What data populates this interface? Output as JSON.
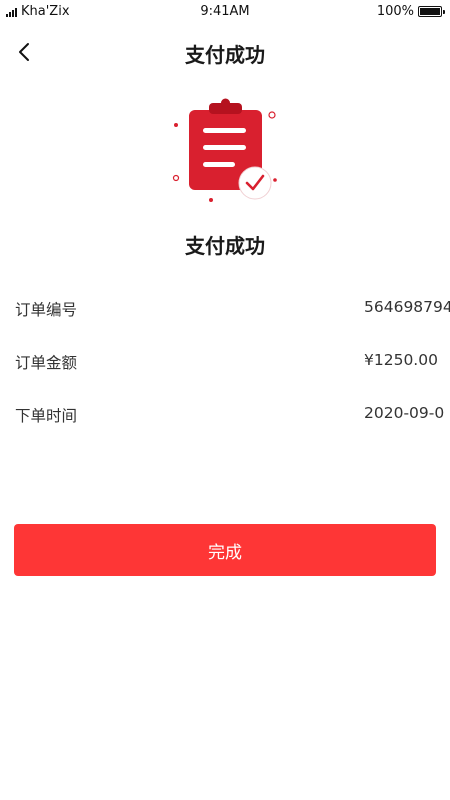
{
  "status_bar": {
    "carrier": "Kha'Zix",
    "time": "9:41AM",
    "battery_percent": "100%",
    "battery_level": 1.0
  },
  "nav": {
    "title": "支付成功",
    "back_icon": "chevron-left-icon"
  },
  "illustration": {
    "icon": "clipboard-check-icon",
    "accent_color": "#d9202f",
    "check_color": "#d9202f"
  },
  "result": {
    "title": "支付成功"
  },
  "order_info": [
    {
      "label": "订单编号",
      "value": "564698794"
    },
    {
      "label": "订单金额",
      "value": "¥1250.00"
    },
    {
      "label": "下单时间",
      "value": "2020-09-0"
    }
  ],
  "done_button": {
    "label": "完成",
    "color": "#fe3636"
  }
}
